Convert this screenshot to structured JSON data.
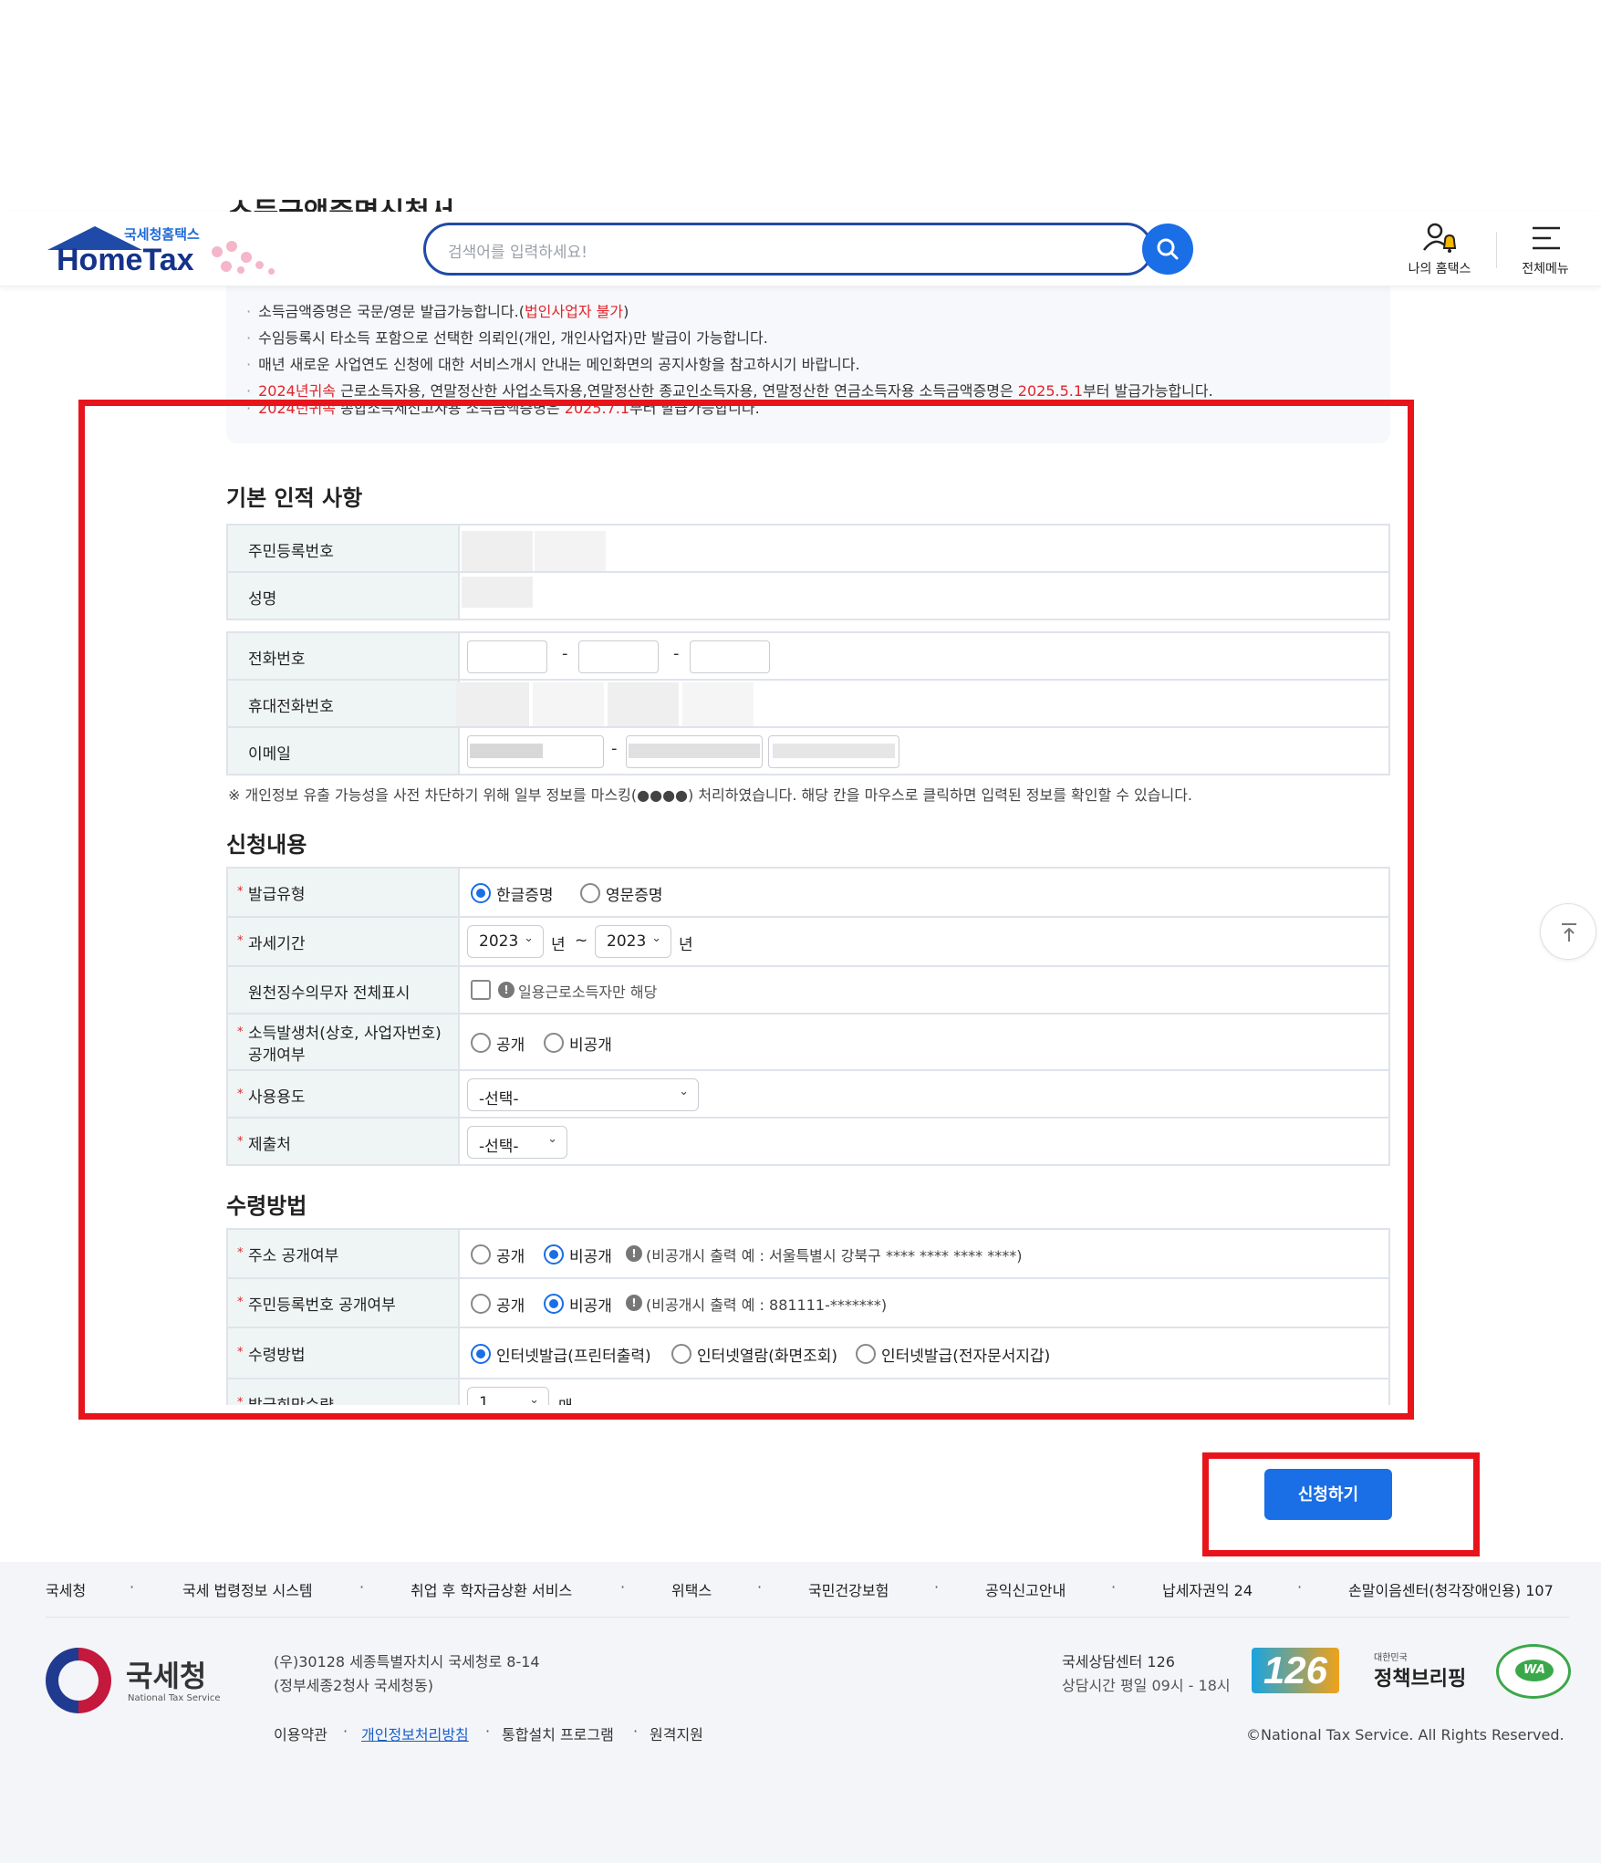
{
  "header": {
    "logo_sub": "국세청홈택스",
    "logo_main": "HomeTax",
    "search_placeholder": "검색어를 입력하세요!",
    "my_hometax": "나의 홈택스",
    "all_menu": "전체메뉴"
  },
  "page_title_partial": "소득금액증명신청서",
  "notice": {
    "line1_a": "소득금액증명은 국문/영문 발급가능합니다.(",
    "line1_red": "법인사업자 불가",
    "line1_b": ")",
    "line2": "수임등록시 타소득 포함으로 선택한 의뢰인(개인, 개인사업자)만 발급이 가능합니다.",
    "line3": "매년 새로운 사업연도 신청에 대한 서비스개시 안내는 메인화면의 공지사항을 참고하시기 바랍니다.",
    "line4_red1": "2024년귀속",
    "line4_mid": " 근로소득자용, 연말정산한 사업소득자용,연말정산한 종교인소득자용, 연말정산한 연금소득자용 소득금액증명은 ",
    "line4_red2": "2025.5.1",
    "line4_end": "부터 발급가능합니다.",
    "line5_red1": "2024년귀속",
    "line5_mid": " 종합소득세신고자용 소득금액증명은 ",
    "line5_red2": "2025.7.1",
    "line5_end": "부터 발급가능합니다."
  },
  "basic": {
    "title": "기본 인적 사항",
    "rrn_label": "주민등록번호",
    "name_label": "성명",
    "phone_label": "전화번호",
    "mobile_label": "휴대전화번호",
    "email_label": "이메일",
    "dash": "-",
    "mask_note": "※ 개인정보 유출 가능성을 사전 차단하기 위해 일부 정보를 마스킹(●●●●) 처리하였습니다. 해당 칸을 마우스로 클릭하면 입력된 정보를 확인할 수 있습니다."
  },
  "apply": {
    "title": "신청내용",
    "req": "*",
    "issue_type_label": "발급유형",
    "korean": "한글증명",
    "english": "영문증명",
    "tax_period_label": "과세기간",
    "year_from": "2023",
    "year_to": "2023",
    "year_unit": "년",
    "tilde": "~",
    "withholder_label": "원천징수의무자 전체표시",
    "daily_worker_note": "일용근로소득자만 해당",
    "income_source_label1": "소득발생처(상호, 사업자번호)",
    "income_source_label2": "공개여부",
    "public": "공개",
    "private": "비공개",
    "usage_label": "사용용도",
    "usage_select": "-선택-",
    "submit_to_label": "제출처",
    "submit_to_select": "-선택-"
  },
  "receive": {
    "title": "수령방법",
    "address_label": "주소 공개여부",
    "address_note": "(비공개시 출력 예 : 서울특별시 강북구 **** **** **** ****)",
    "rrn_public_label": "주민등록번호 공개여부",
    "rrn_note": "(비공개시 출력 예 : 881111-*******)",
    "method_label": "수령방법",
    "method1": "인터넷발급(프린터출력)",
    "method2": "인터넷열람(화면조회)",
    "method3": "인터넷발급(전자문서지갑)",
    "copies_label": "발급희망수량",
    "copies_value": "1",
    "copies_unit": "매"
  },
  "apply_button": "신청하기",
  "footer": {
    "links": [
      "국세청",
      "국세 법령정보 시스템",
      "취업 후 학자금상환 서비스",
      "위택스",
      "국민건강보험",
      "공익신고안내",
      "납세자권익 24",
      "손말이음센터(청각장애인용) 107"
    ],
    "org_name": "국세청",
    "org_eng": "National Tax Service",
    "address1": "(우)30128 세종특별자치시 국세청로 8-14",
    "address2": "(정부세종2청사 국세청동)",
    "sub_links": [
      "이용약관",
      "개인정보처리방침",
      "통합설치 프로그램",
      "원격지원"
    ],
    "call_center": "국세상담센터 126",
    "call_hours": "상담시간 평일 09시 - 18시",
    "badge_126": "126",
    "policy_small": "대한민국",
    "policy_big": "정책브리핑",
    "wa": "WA",
    "copyright": "©National Tax Service. All Rights Reserved."
  },
  "colors": {
    "primary_blue": "#1a6ee6",
    "brand_navy": "#1f4aa8",
    "highlight_red": "#e8141b",
    "required_red": "#e0252b",
    "th_bg": "#eff5f4"
  }
}
